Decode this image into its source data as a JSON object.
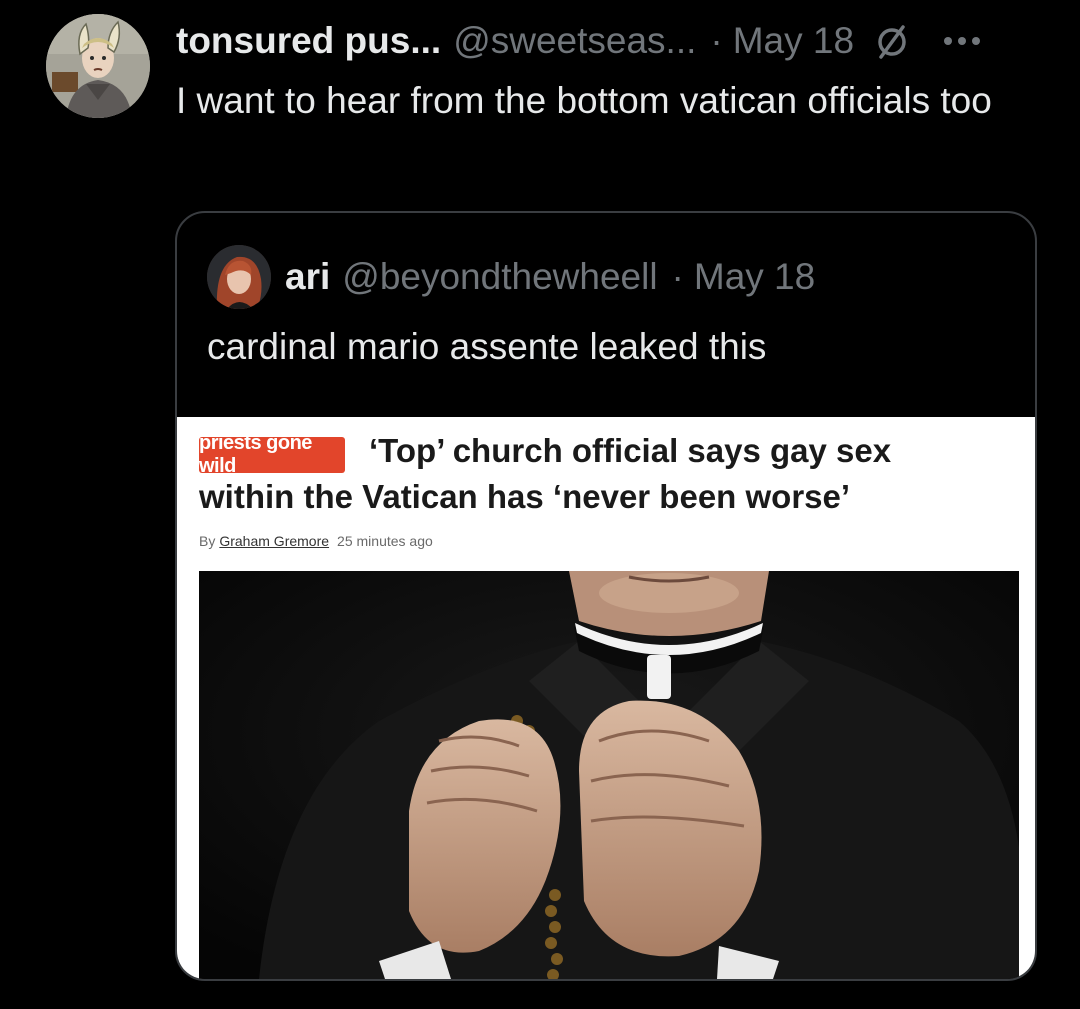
{
  "tweet": {
    "display_name": "tonsured pus...",
    "handle": "@sweetseas...",
    "separator": "·",
    "date": "May 18",
    "text": "I want to hear from the bottom vatican officials too",
    "avatar_icon": "cartoon-monk-avatar",
    "status_icon": "null-circle-icon",
    "more_icon": "more-options-icon"
  },
  "quoted_tweet": {
    "display_name": "ari",
    "handle": "@beyondthewheell",
    "separator": "·",
    "date": "May 18",
    "text": "cardinal mario assente leaked this",
    "avatar_icon": "profile-photo-avatar"
  },
  "article": {
    "tag": "priests gone wild",
    "headline_line1": "‘Top’ church official says gay sex",
    "headline_line2": "within the Vatican has ‘never been worse’",
    "byline_prefix": "By",
    "author": "Graham Gremore",
    "time": "25 minutes ago",
    "image_subject": "priest-holding-rosary-photo",
    "tag_color": "#e2452b"
  }
}
